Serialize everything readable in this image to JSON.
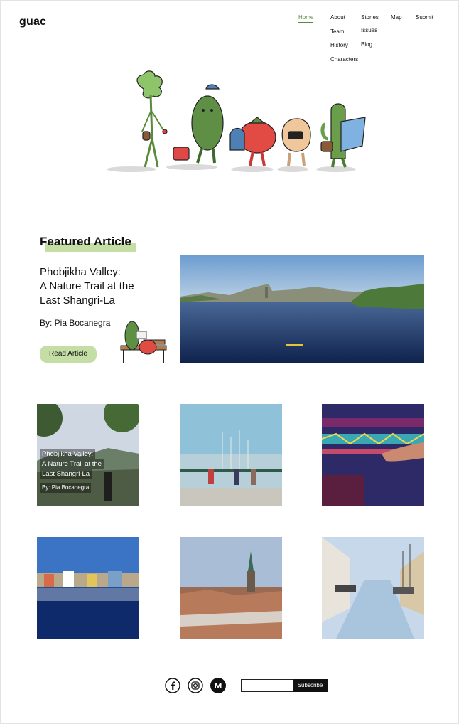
{
  "brand": {
    "logo": "guac"
  },
  "nav": {
    "home": "Home",
    "about": "About",
    "team": "Team",
    "history": "History",
    "characters": "Characters",
    "stories": "Stories",
    "issues": "Issues",
    "blog": "Blog",
    "map": "Map",
    "submit": "Submit",
    "active": "Home"
  },
  "hero": {
    "image": "veggie-characters-walking-illustration"
  },
  "featured": {
    "section_title": "Featured Article",
    "headline_lines": [
      "Phobjikha Valley:",
      "A Nature Trail at the",
      "Last Shangri-La"
    ],
    "author": "By: Pia Bocanegra",
    "button": "Read Article",
    "image": "river-city-skyline-photo"
  },
  "grid": [
    {
      "image": "mountain-valley-tree-photo",
      "caption_lines": [
        "Phobjikha Valley:",
        "A Nature Trail at the",
        "Last Shangri-La"
      ],
      "author": "By: Pia Bocanegra"
    },
    {
      "image": "harbor-viewpoint-people-photo"
    },
    {
      "image": "woven-textile-hand-photo"
    },
    {
      "image": "colorful-houses-reflection-photo"
    },
    {
      "image": "city-rooftops-spire-photo"
    },
    {
      "image": "frozen-canal-boats-photo"
    }
  ],
  "footer": {
    "social": [
      "facebook-icon",
      "instagram-icon",
      "medium-icon"
    ],
    "subscribe_placeholder": "",
    "subscribe_button": "Subscribe"
  },
  "colors": {
    "accent_green": "#c4dea6",
    "nav_active": "#5a8a3c",
    "dark": "#111111"
  }
}
